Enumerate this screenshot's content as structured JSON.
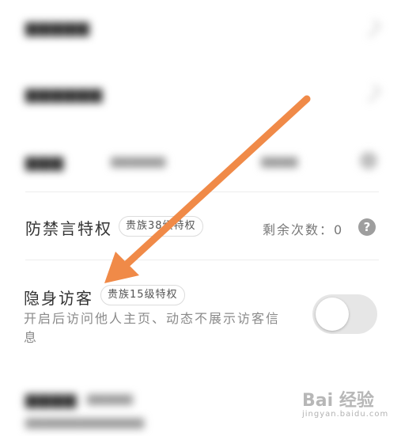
{
  "anti_mute": {
    "title": "防禁言特权",
    "badge": "贵族38级特权",
    "remaining_label": "剩余次数：0",
    "help_glyph": "?"
  },
  "invisible_visitor": {
    "title": "隐身访客",
    "badge": "贵族15级特权",
    "description_line1": "开启后访问他人主页、动态不展示访客信",
    "description_line2": "息",
    "toggle_on": false
  },
  "colors": {
    "arrow": "#f08a48",
    "toggle_track_off": "#e6e6e6",
    "text_primary": "#333333",
    "text_secondary": "#8a8a8a"
  },
  "watermark": {
    "brand": "Bai 经验",
    "url": "jingyan.baidu.com"
  }
}
